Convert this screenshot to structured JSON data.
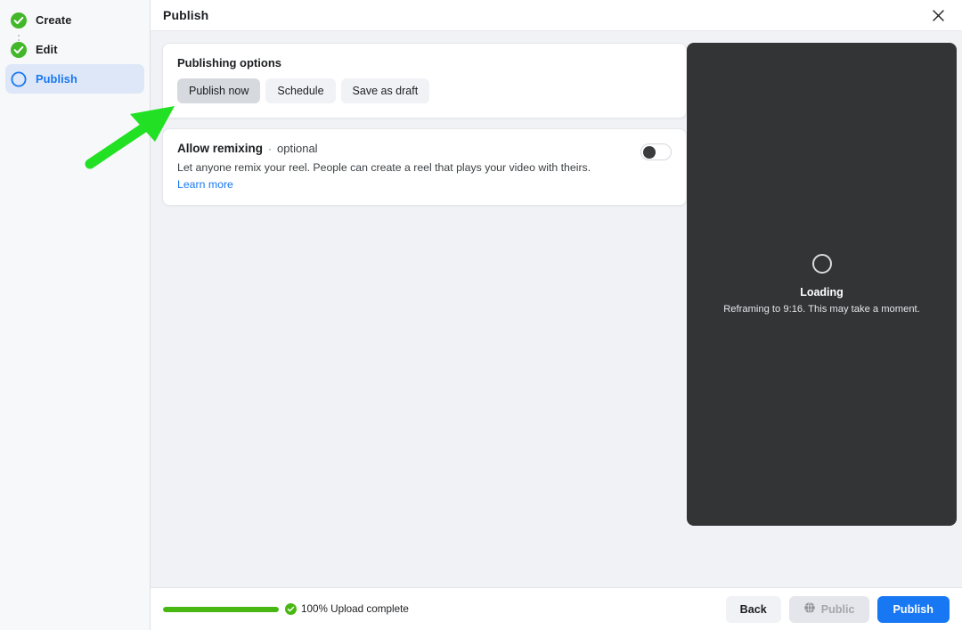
{
  "window": {
    "title": "Publish",
    "close_icon": "close-icon"
  },
  "sidebar": {
    "steps": [
      {
        "label": "Create",
        "state": "complete",
        "icon": "check-circle-icon"
      },
      {
        "label": "Edit",
        "state": "complete",
        "icon": "check-circle-icon"
      },
      {
        "label": "Publish",
        "state": "current",
        "icon": "circle-outline-icon"
      }
    ]
  },
  "publishing_options": {
    "title": "Publishing options",
    "buttons": [
      {
        "label": "Publish now",
        "selected": true
      },
      {
        "label": "Schedule",
        "selected": false
      },
      {
        "label": "Save as draft",
        "selected": false
      }
    ]
  },
  "allow_remixing": {
    "title": "Allow remixing",
    "separator": "·",
    "optional_label": "optional",
    "description": "Let anyone remix your reel. People can create a reel that plays your video with theirs.",
    "link_label": "Learn more",
    "toggle_state": "off",
    "toggle_name": "allow-remixing-toggle"
  },
  "preview": {
    "status_title": "Loading",
    "status_subtitle": "Reframing to 9:16. This may take a moment.",
    "spinner_icon": "loading-spinner-icon",
    "background_color": "#333436"
  },
  "footer": {
    "progress_percent": 100,
    "progress_label": "100% Upload complete",
    "progress_icon": "check-circle-icon",
    "progress_color": "#48b711",
    "back_label": "Back",
    "audience_label": "Public",
    "audience_icon": "globe-icon",
    "publish_label": "Publish"
  },
  "annotation": {
    "arrow_color": "#22e024",
    "arrow_name": "highlight-arrow"
  },
  "colors": {
    "accent_blue": "#1877f2",
    "success_green": "#42b72a",
    "active_step_bg": "#dde7f7"
  }
}
